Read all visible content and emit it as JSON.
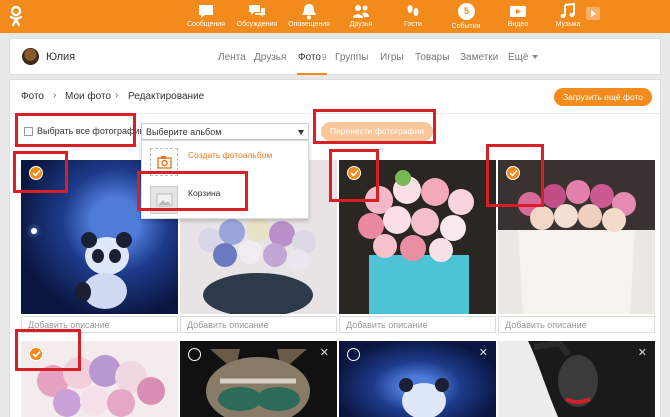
{
  "topnav": {
    "items": [
      {
        "label": "Сообщения",
        "icon": "messages-icon"
      },
      {
        "label": "Обсуждения",
        "icon": "discussions-icon"
      },
      {
        "label": "Оповещения",
        "icon": "bell-icon"
      },
      {
        "label": "Друзья",
        "icon": "friends-icon"
      },
      {
        "label": "Гости",
        "icon": "footprints-icon"
      },
      {
        "label": "События",
        "icon": "events-icon",
        "badge": "5"
      },
      {
        "label": "Видео",
        "icon": "video-icon"
      },
      {
        "label": "Музыка",
        "icon": "music-icon"
      }
    ]
  },
  "profile": {
    "name": "Юлия",
    "tabs": [
      {
        "label": "Лента"
      },
      {
        "label": "Друзья"
      },
      {
        "label": "Фото",
        "count": "9",
        "active": true
      },
      {
        "label": "Группы"
      },
      {
        "label": "Игры"
      },
      {
        "label": "Товары"
      },
      {
        "label": "Заметки"
      },
      {
        "label": "Ещё"
      }
    ]
  },
  "breadcrumb": [
    "Фото",
    "Мои фото",
    "Редактирование"
  ],
  "upload_button": "Загрузить ещё фото",
  "toolbar": {
    "select_all_label": "Выбрать все фотографии",
    "album_select_value": "Выберите альбом",
    "move_button": "Перенести фотографии"
  },
  "dropdown": {
    "items": [
      {
        "label": "Создать фотоальбом"
      },
      {
        "label": "Корзина"
      }
    ]
  },
  "photos": {
    "description_placeholder": "Добавить описание",
    "items": [
      {
        "subject": "panda",
        "selected": true
      },
      {
        "subject": "flowers",
        "selected": false
      },
      {
        "subject": "flowers",
        "selected": true
      },
      {
        "subject": "roses",
        "selected": true
      },
      {
        "subject": "flowers",
        "selected": true
      },
      {
        "subject": "raccoon",
        "selected": false
      },
      {
        "subject": "panda",
        "selected": false
      },
      {
        "subject": "woman",
        "selected": false
      }
    ]
  },
  "colors": {
    "brand_orange": "#f28a1c",
    "annotation_red": "#d91f26"
  }
}
